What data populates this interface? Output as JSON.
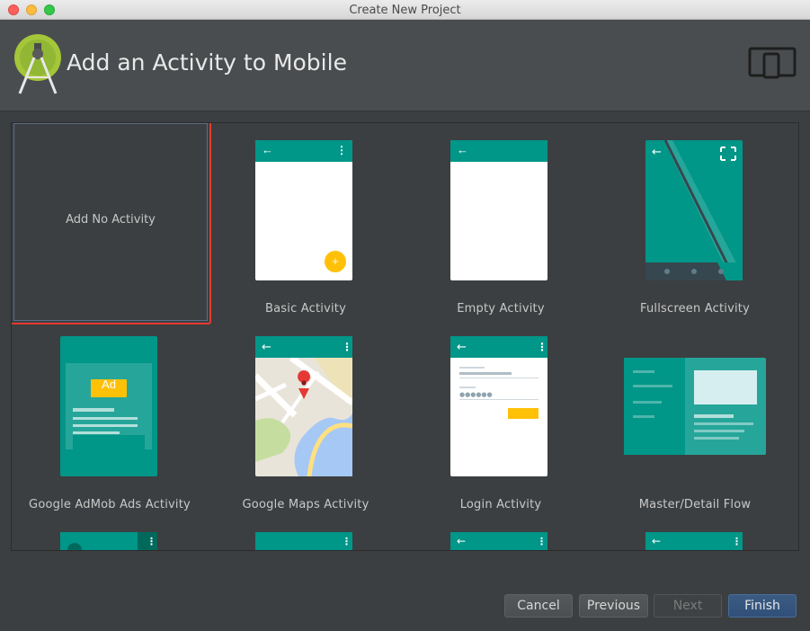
{
  "window": {
    "title": "Create New Project"
  },
  "header": {
    "title": "Add an Activity to Mobile"
  },
  "activities": [
    {
      "label": "Add No Activity",
      "selected": true
    },
    {
      "label": "Basic Activity"
    },
    {
      "label": "Empty Activity"
    },
    {
      "label": "Fullscreen Activity"
    },
    {
      "label": "Google AdMob Ads Activity",
      "ad_badge": "Ad"
    },
    {
      "label": "Google Maps Activity"
    },
    {
      "label": "Login Activity"
    },
    {
      "label": "Master/Detail Flow"
    }
  ],
  "buttons": {
    "cancel": "Cancel",
    "previous": "Previous",
    "next": "Next",
    "finish": "Finish"
  },
  "colors": {
    "accent_teal": "#009688",
    "selection_red": "#e33b2e",
    "fab_yellow": "#ffc107"
  }
}
